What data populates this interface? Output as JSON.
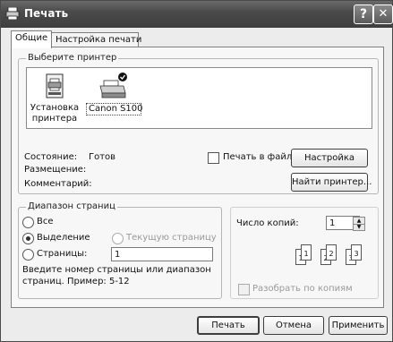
{
  "window": {
    "title": "Печать"
  },
  "titlebar": {
    "help_glyph": "?",
    "close_glyph": "✕"
  },
  "tabs": [
    {
      "label": "Общие",
      "active": true
    },
    {
      "label": "Настройка печати",
      "active": false
    }
  ],
  "printer_group": {
    "legend": "Выберите принтер",
    "printers": [
      {
        "label": "Установка принтера",
        "line1": "Установка",
        "line2": "принтера",
        "icon": "add-printer-icon"
      },
      {
        "label": "Canon S100",
        "icon": "printer-icon",
        "selected": true,
        "default": true
      }
    ],
    "status_label": "Состояние:",
    "status_value": "Готов",
    "location_label": "Размещение:",
    "comment_label": "Комментарий:",
    "print_to_file_label": "Печать в файл",
    "preferences_button": "Настройка",
    "find_printer_button": "Найти принтер..."
  },
  "page_range": {
    "legend": "Диапазон страниц",
    "all_label": "Все",
    "selection_label": "Выделение",
    "current_page_label": "Текущую страницу",
    "pages_label": "Страницы:",
    "pages_value": "1",
    "hint": "Введите номер страницы или диапазон страниц.  Пример: 5-12",
    "hint_line1": "Введите номер страницы или диапазон",
    "hint_line2": "страниц.  Пример: 5-12",
    "selected_option": "Выделение"
  },
  "copies": {
    "label": "Число копий:",
    "value": "1",
    "collate_label": "Разобрать по копиям",
    "collate_checked": false,
    "collate_enabled": false,
    "sheet_numbers": [
      "1",
      "1",
      "2",
      "2",
      "3",
      "3"
    ]
  },
  "footer": {
    "print_button": "Печать",
    "cancel_button": "Отмена",
    "apply_button": "Применить"
  }
}
